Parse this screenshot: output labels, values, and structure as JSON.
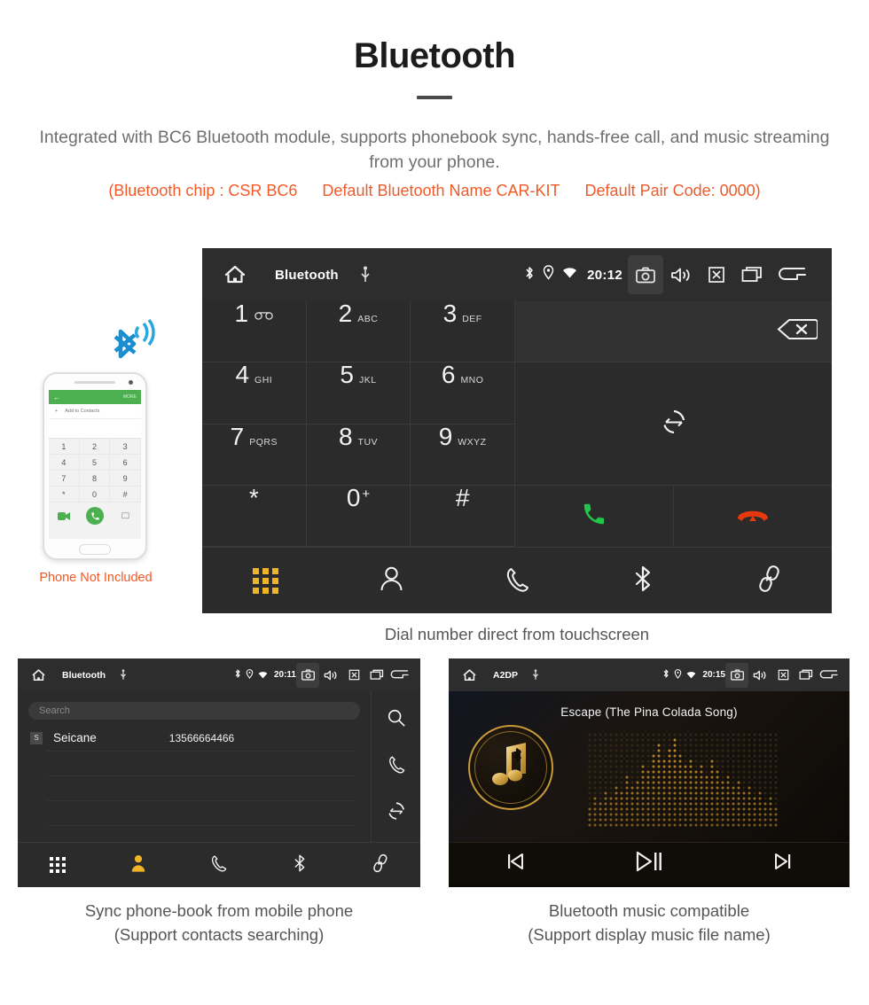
{
  "header": {
    "title": "Bluetooth",
    "subtitle": "Integrated with BC6 Bluetooth module, supports phonebook sync, hands-free call, and music streaming from your phone.",
    "spec_open": "(Bluetooth chip : CSR BC6",
    "spec_name": "Default Bluetooth Name CAR-KIT",
    "spec_pair": "Default Pair Code: 0000)",
    "accent_color": "#f05a28",
    "text_color": "#6f6f6f"
  },
  "dialer": {
    "statusbar": {
      "home_icon": "home-icon",
      "title": "Bluetooth",
      "usb_icon": "usb-icon",
      "bluetooth_icon": "bluetooth-icon",
      "location_icon": "location-pin-icon",
      "wifi_icon": "wifi-icon",
      "clock": "20:12",
      "camera_icon": "camera-icon",
      "volume_icon": "volume-icon",
      "close_icon": "close-box-icon",
      "recents_icon": "recents-icon",
      "back_icon": "back-arrow-icon"
    },
    "keys": [
      {
        "num": "1",
        "sub": "",
        "voicemail": true
      },
      {
        "num": "2",
        "sub": "ABC"
      },
      {
        "num": "3",
        "sub": "DEF"
      },
      {
        "num": "4",
        "sub": "GHI"
      },
      {
        "num": "5",
        "sub": "JKL"
      },
      {
        "num": "6",
        "sub": "MNO"
      },
      {
        "num": "7",
        "sub": "PQRS"
      },
      {
        "num": "8",
        "sub": "TUV"
      },
      {
        "num": "9",
        "sub": "WXYZ"
      },
      {
        "num": "*",
        "sub": ""
      },
      {
        "num": "0",
        "sub": "",
        "plus": "+"
      },
      {
        "num": "#",
        "sub": ""
      }
    ],
    "backspace_icon": "backspace-icon",
    "sync_icon": "sync-icon",
    "call_icon": "call-answer-icon",
    "hangup_icon": "call-end-icon",
    "call_color": "#21c64a",
    "hangup_color": "#e8380d",
    "tabs": [
      {
        "icon": "keypad-icon",
        "active": true
      },
      {
        "icon": "contacts-icon",
        "active": false
      },
      {
        "icon": "call-history-icon",
        "active": false
      },
      {
        "icon": "bluetooth-icon",
        "active": false
      },
      {
        "icon": "link-pair-icon",
        "active": false
      }
    ],
    "active_tab_color": "#f0b429",
    "caption": "Dial number direct from touchscreen"
  },
  "phone_mock": {
    "note": "Phone Not Included",
    "note_color": "#f05a28",
    "screen": {
      "back_icon": "back-arrow-icon",
      "more_label": "MORE",
      "add_label": "Add to Contacts",
      "keys": [
        "1",
        "2",
        "3",
        "4",
        "5",
        "6",
        "7",
        "8",
        "9",
        "*",
        "0",
        "#"
      ],
      "call_icon": "call-answer-icon",
      "video_icon": "video-call-icon",
      "keyboard_icon": "keyboard-icon"
    },
    "bluetooth_badge_icon": "bluetooth-signal-icon",
    "bluetooth_badge_color": "#2196d6"
  },
  "phonebook_shot": {
    "statusbar": {
      "home_icon": "home-icon",
      "title": "Bluetooth",
      "usb_icon": "usb-icon",
      "clock": "20:11",
      "camera_icon": "camera-icon",
      "volume_icon": "volume-icon",
      "close_icon": "close-box-icon",
      "recents_icon": "recents-icon",
      "back_icon": "back-arrow-icon"
    },
    "search_placeholder": "Search",
    "contacts": [
      {
        "initial": "S",
        "name": "Seicane",
        "number": "13566664466"
      }
    ],
    "side_actions": [
      {
        "icon": "search-icon"
      },
      {
        "icon": "call-history-icon"
      },
      {
        "icon": "sync-icon"
      }
    ],
    "tabs": [
      {
        "icon": "keypad-icon",
        "active": false
      },
      {
        "icon": "contacts-icon",
        "active": true
      },
      {
        "icon": "call-history-icon",
        "active": false
      },
      {
        "icon": "bluetooth-icon",
        "active": false
      },
      {
        "icon": "link-pair-icon",
        "active": false
      }
    ],
    "active_tab_color": "#f0b429",
    "caption_line1": "Sync phone-book from mobile phone",
    "caption_line2": "(Support contacts searching)"
  },
  "music_shot": {
    "statusbar": {
      "home_icon": "home-icon",
      "title": "A2DP",
      "usb_icon": "usb-icon",
      "clock": "20:15",
      "camera_icon": "camera-icon",
      "volume_icon": "volume-icon",
      "close_icon": "close-box-icon",
      "recents_icon": "recents-icon",
      "back_icon": "back-arrow-icon"
    },
    "track_title": "Escape (The Pina Colada Song)",
    "album_icon": "music-note-bluetooth-icon",
    "gold_color": "#c79a3a",
    "controls": [
      {
        "icon": "previous-track-icon"
      },
      {
        "icon": "play-pause-icon"
      },
      {
        "icon": "next-track-icon"
      }
    ],
    "caption_line1": "Bluetooth music compatible",
    "caption_line2": "(Support display music file name)"
  }
}
